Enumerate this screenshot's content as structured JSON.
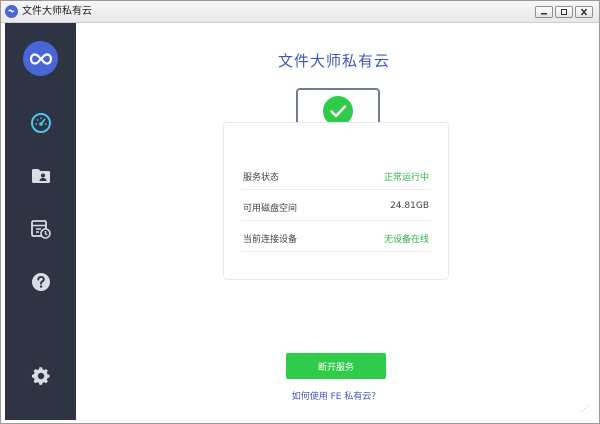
{
  "window": {
    "title": "文件大师私有云"
  },
  "sidebar": {
    "items": [
      {
        "name": "dashboard",
        "icon": "speedometer-icon",
        "active": true
      },
      {
        "name": "shared-folder",
        "icon": "user-folder-icon",
        "active": false
      },
      {
        "name": "history",
        "icon": "calendar-clock-icon",
        "active": false
      },
      {
        "name": "help",
        "icon": "question-icon",
        "active": false
      },
      {
        "name": "settings",
        "icon": "gear-icon",
        "active": false
      }
    ]
  },
  "main": {
    "title": "文件大师私有云",
    "status_rows": [
      {
        "label": "服务状态",
        "value": "正常运行中"
      },
      {
        "label": "可用磁盘空间",
        "value": "24.81GB"
      },
      {
        "label": "当前连接设备",
        "value": "无设备在线"
      }
    ],
    "primary_button": "断开服务",
    "help_link": "如何使用 FE 私有云？"
  },
  "colors": {
    "accent": "#4a66d6",
    "title_blue": "#4058b8",
    "success_green": "#2ecc48",
    "sidebar_bg": "#2e3443",
    "active_icon": "#4fc3e8",
    "inactive_icon": "#d8dce3"
  }
}
